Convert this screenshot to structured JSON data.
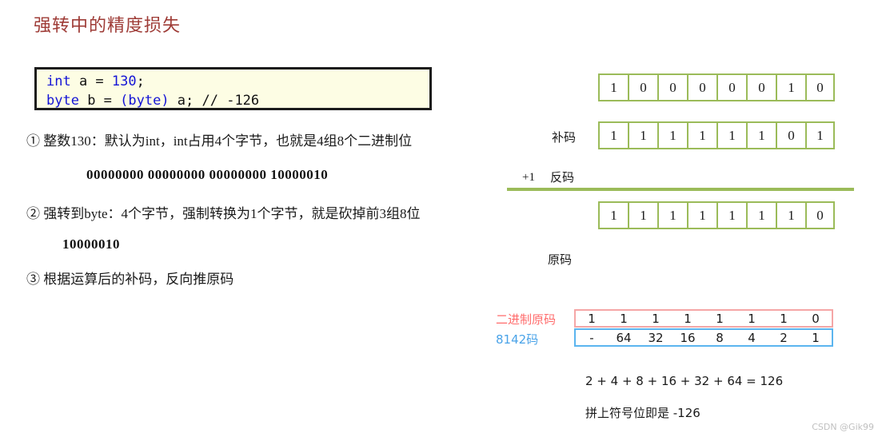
{
  "page": {
    "title": "强转中的精度损失",
    "title_color": "#9e3b36",
    "watermark": "CSDN @Gik99"
  },
  "code": {
    "line1": {
      "kw": "int",
      "mid": " a = ",
      "num": "130",
      "end": ";"
    },
    "line2": {
      "kw": "byte",
      "mid": " b = ",
      "cast": "(byte)",
      "end": " a;  // -126"
    }
  },
  "steps": {
    "item1": "① 整数130：默认为int，int占用4个字节，也就是4组8个二进制位",
    "item1_binary": "00000000 00000000 00000000 10000010",
    "item2": "② 强转到byte：4个字节，强制转换为1个字节，就是砍掉前3组8位",
    "item2_binary": "10000010",
    "item3": "③ 根据运算后的补码，反向推原码"
  },
  "bit_rows": {
    "row_top": [
      "1",
      "0",
      "0",
      "0",
      "0",
      "0",
      "1",
      "0"
    ],
    "row_complement": [
      "1",
      "1",
      "1",
      "1",
      "1",
      "1",
      "0",
      "1"
    ],
    "row_inverse": [
      "1",
      "1",
      "1",
      "1",
      "1",
      "1",
      "1",
      "0"
    ],
    "label_complement": "补码",
    "label_inverse": "反码",
    "label_original": "原码",
    "label_plus_one": "+1",
    "border_color": "#9bbb59"
  },
  "decode": {
    "label_binary": "二进制原码",
    "label_binary_color": "#ff6b6b",
    "label_code": "8142码",
    "label_code_color": "#4aa3e8",
    "binary_values": [
      "1",
      "1",
      "1",
      "1",
      "1",
      "1",
      "1",
      "0"
    ],
    "weight_values": [
      "-",
      "64",
      "32",
      "16",
      "8",
      "4",
      "2",
      "1"
    ],
    "note_sum": "2 + 4 + 8 + 16 + 32 + 64 = 126",
    "note_sign": "拼上符号位即是 -126"
  }
}
